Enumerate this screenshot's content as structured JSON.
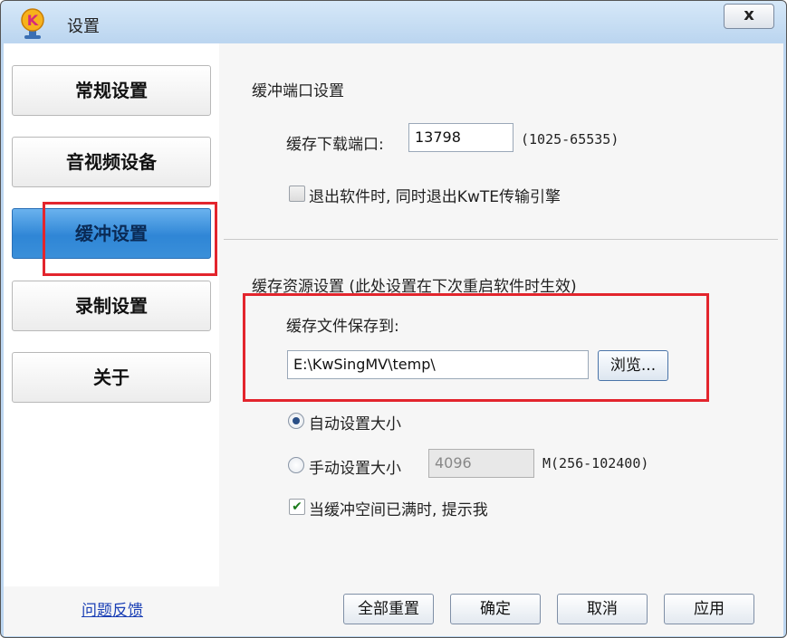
{
  "window": {
    "title": "设置",
    "close_label": "x"
  },
  "sidebar": {
    "items": [
      {
        "label": "常规设置",
        "active": false
      },
      {
        "label": "音视频设备",
        "active": false
      },
      {
        "label": "缓冲设置",
        "active": true
      },
      {
        "label": "录制设置",
        "active": false
      },
      {
        "label": "关于",
        "active": false
      }
    ]
  },
  "buffer_port": {
    "section_title": "缓冲端口设置",
    "port_label": "缓存下载端口:",
    "port_value": "13798",
    "port_hint": "(1025-65535)",
    "exit_checkbox_label": "退出软件时, 同时退出KwTE传输引擎",
    "exit_checkbox_checked": false
  },
  "cache_resource": {
    "section_title": "缓存资源设置 (此处设置在下次重启软件时生效)",
    "save_to_label": "缓存文件保存到:",
    "save_path": "E:\\KwSingMV\\temp\\",
    "browse_label": "浏览...",
    "auto_size_label": "自动设置大小",
    "auto_size_selected": true,
    "manual_size_label": "手动设置大小",
    "manual_size_value": "4096",
    "manual_size_hint": "M(256-102400)",
    "notify_full_label": "当缓冲空间已满时, 提示我",
    "notify_full_checked": true
  },
  "footer": {
    "feedback_link": "问题反馈",
    "reset_all_label": "全部重置",
    "ok_label": "确定",
    "cancel_label": "取消",
    "apply_label": "应用"
  },
  "colors": {
    "highlight": "#e3252d",
    "active_nav": "#3a8fd9",
    "link": "#1a3fb5"
  }
}
